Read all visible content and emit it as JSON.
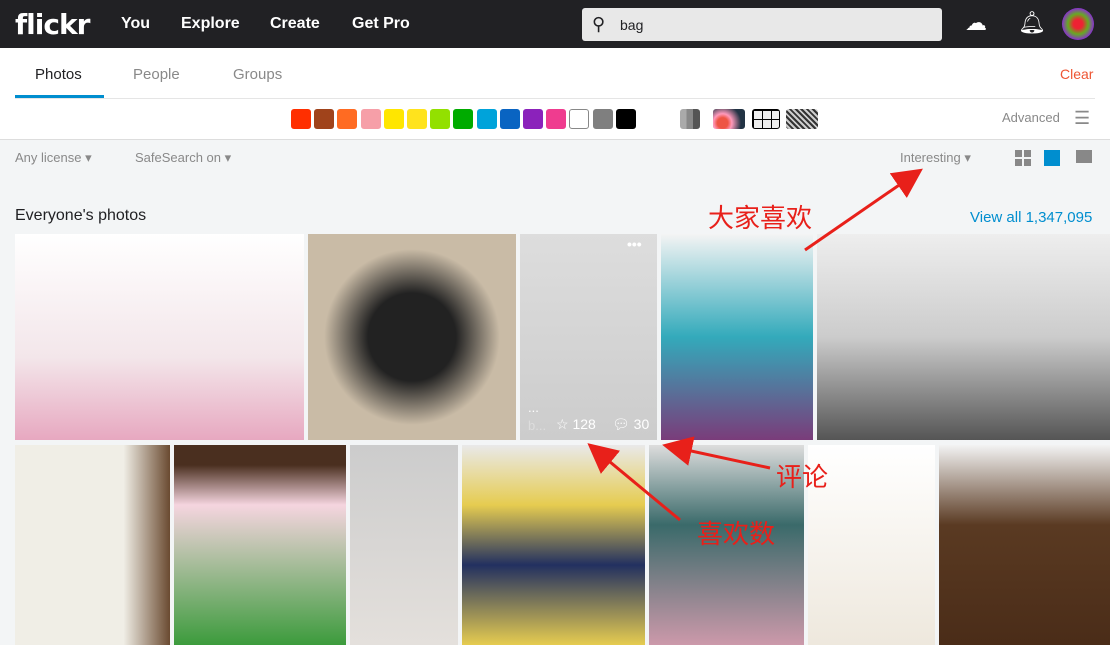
{
  "header": {
    "logo": "flickr",
    "nav": [
      "You",
      "Explore",
      "Create",
      "Get Pro"
    ],
    "search_value": "bag",
    "icons": [
      "upload-cloud-icon",
      "bell-icon",
      "avatar"
    ]
  },
  "tabs": [
    {
      "label": "Photos",
      "active": true
    },
    {
      "label": "People"
    },
    {
      "label": "Groups"
    }
  ],
  "clear_label": "Clear",
  "colors": [
    "#ff2f00",
    "#a0431b",
    "#ff6b22",
    "#f69fa8",
    "#ffe600",
    "#ffe31d",
    "#93e000",
    "#00ab00",
    "#00a3da",
    "#0964c2",
    "#8b22bb",
    "#ef3c8f",
    "#ffffff",
    "#7f7f7f",
    "#000000"
  ],
  "advanced_label": "Advanced",
  "filters": {
    "license": "Any license",
    "safesearch": "SafeSearch on",
    "sort": "Interesting"
  },
  "section": {
    "title": "Everyone's photos",
    "view_all": "View all 1,347,095"
  },
  "hover_photo": {
    "owner": "b...",
    "title": "...",
    "faves": "128",
    "comments": "30"
  },
  "annotations": {
    "interesting": "大家喜欢",
    "comments": "评论",
    "faves": "喜欢数"
  },
  "annotation_color": "#e8201a"
}
